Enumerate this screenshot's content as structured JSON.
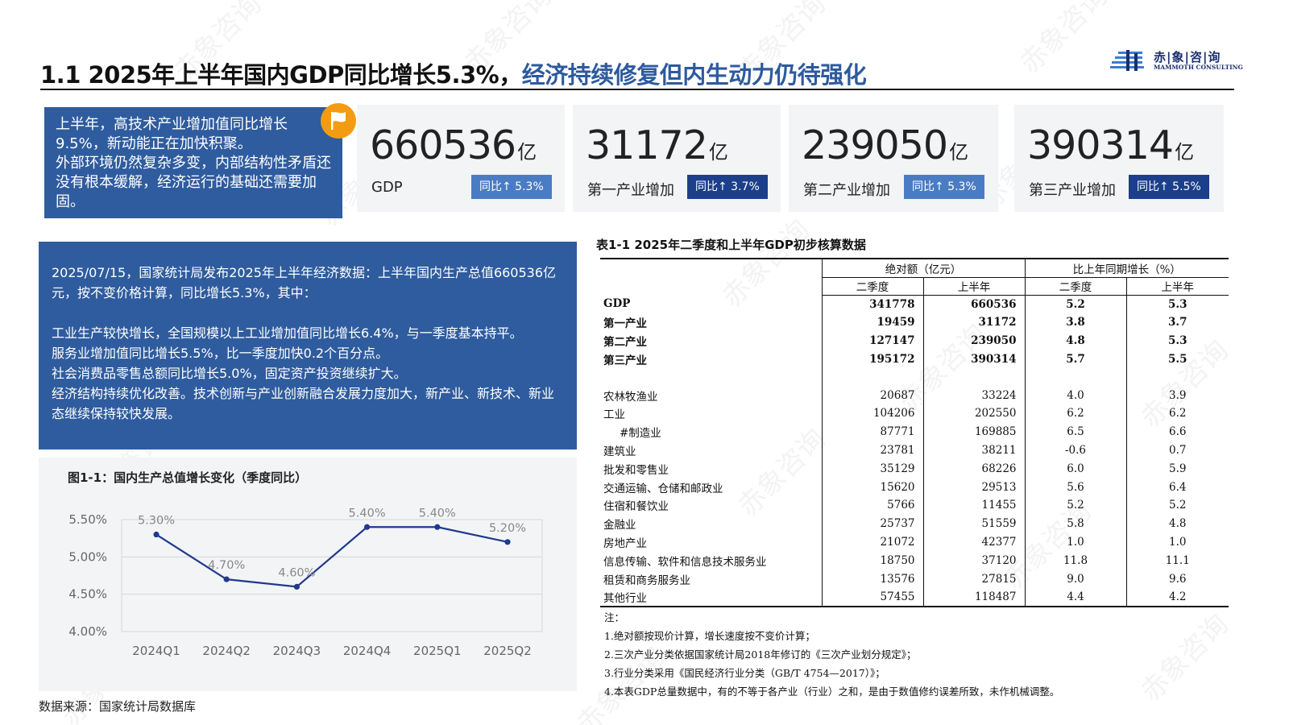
{
  "header": {
    "title_part1": "1.1 2025年上半年国内GDP同比增长5.3%，",
    "title_part2": "经济持续修复但内生动力仍待强化",
    "logo_cn": "赤|象|咨|询",
    "logo_en": "MAMMOTH CONSULTING",
    "watermark": "赤象咨询"
  },
  "summary": {
    "lines": [
      "上半年，高技术产业增加值同比增长9.5%，新动能正在加快积聚。",
      "外部环境仍然复杂多变，内部结构性矛盾还没有根本缓解，经济运行的基础还需要加固。"
    ]
  },
  "kpis": [
    {
      "value": "660536",
      "unit": "亿",
      "label": "GDP",
      "badge": "同比↑ 5.3%",
      "badge_style": "light"
    },
    {
      "value": "31172",
      "unit": "亿",
      "label": "第一产业增加",
      "badge": "同比↑ 3.7%",
      "badge_style": "dark"
    },
    {
      "value": "239050",
      "unit": "亿",
      "label": "第二产业增加",
      "badge": "同比↑ 5.3%",
      "badge_style": "light"
    },
    {
      "value": "390314",
      "unit": "亿",
      "label": "第三产业增加",
      "badge": "同比↑ 5.5%",
      "badge_style": "dark"
    }
  ],
  "detail": {
    "intro": "2025/07/15，国家统计局发布2025年上半年经济数据：上半年国内生产总值660536亿元，按不变价格计算，同比增长5.3%，其中：",
    "points": [
      "工业生产较快增长，全国规模以上工业增加值同比增长6.4%，与一季度基本持平。",
      "服务业增加值同比增长5.5%，比一季度加快0.2个百分点。",
      "社会消费品零售总额同比增长5.0%，固定资产投资继续扩大。",
      "经济结构持续优化改善。技术创新与产业创新融合发展力度加大，新产业、新技术、新业态继续保持较快发展。"
    ]
  },
  "chart_data": {
    "type": "line",
    "title": "图1-1：国内生产总值增长变化（季度同比）",
    "categories": [
      "2024Q1",
      "2024Q2",
      "2024Q3",
      "2024Q4",
      "2025Q1",
      "2025Q2"
    ],
    "values": [
      5.3,
      4.7,
      4.6,
      5.4,
      5.4,
      5.2
    ],
    "data_labels": [
      "5.30%",
      "4.70%",
      "4.60%",
      "5.40%",
      "5.40%",
      "5.20%"
    ],
    "y_ticks": [
      "5.50%",
      "5.00%",
      "4.50%",
      "4.00%"
    ],
    "y_tick_values": [
      5.5,
      5.0,
      4.5,
      4.0
    ],
    "ylim": [
      4.0,
      5.5
    ],
    "grid": true,
    "line_color": "#1f3a8c"
  },
  "source": "数据来源：国家统计局数据库",
  "table": {
    "title": "表1-1   2025年二季度和上半年GDP初步核算数据",
    "group_headers": [
      "绝对额（亿元）",
      "比上年同期增长（%）"
    ],
    "sub_headers": [
      "二季度",
      "上半年",
      "二季度",
      "上半年"
    ],
    "rows_main": [
      [
        "GDP",
        "341778",
        "660536",
        "5.2",
        "5.3"
      ],
      [
        "第一产业",
        "19459",
        "31172",
        "3.8",
        "3.7"
      ],
      [
        "第二产业",
        "127147",
        "239050",
        "4.8",
        "5.3"
      ],
      [
        "第三产业",
        "195172",
        "390314",
        "5.7",
        "5.5"
      ]
    ],
    "rows_detail": [
      [
        "农林牧渔业",
        "20687",
        "33224",
        "4.0",
        "3.9"
      ],
      [
        "工业",
        "104206",
        "202550",
        "6.2",
        "6.2"
      ],
      [
        "#制造业",
        "87771",
        "169885",
        "6.5",
        "6.6"
      ],
      [
        "建筑业",
        "23781",
        "38211",
        "-0.6",
        "0.7"
      ],
      [
        "批发和零售业",
        "35129",
        "68226",
        "6.0",
        "5.9"
      ],
      [
        "交通运输、仓储和邮政业",
        "15620",
        "29513",
        "5.6",
        "6.4"
      ],
      [
        "住宿和餐饮业",
        "5766",
        "11455",
        "5.2",
        "5.2"
      ],
      [
        "金融业",
        "25737",
        "51559",
        "5.8",
        "4.8"
      ],
      [
        "房地产业",
        "21072",
        "42377",
        "1.0",
        "1.0"
      ],
      [
        "信息传输、软件和信息技术服务业",
        "18750",
        "37120",
        "11.8",
        "11.1"
      ],
      [
        "租赁和商务服务业",
        "13576",
        "27815",
        "9.0",
        "9.6"
      ],
      [
        "其他行业",
        "57455",
        "118487",
        "4.4",
        "4.2"
      ]
    ],
    "notes": [
      "注：",
      "1.绝对额按现价计算，增长速度按不变价计算；",
      "2.三次产业分类依据国家统计局2018年修订的《三次产业划分规定》；",
      "3.行业分类采用《国民经济行业分类（GB/T 4754—2017）》；",
      "4.本表GDP总量数据中，有的不等于各产业（行业）之和，是由于数值修约误差所致，未作机械调整。"
    ]
  }
}
